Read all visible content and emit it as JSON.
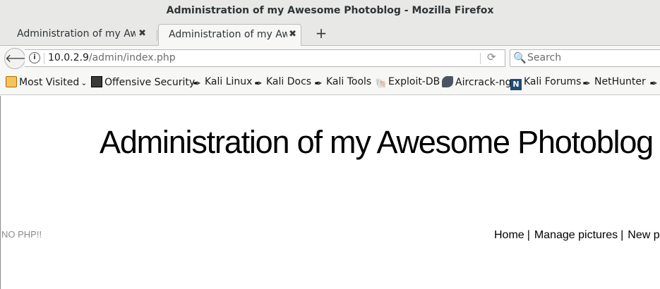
{
  "window": {
    "title": "Administration of my Awesome Photoblog - Mozilla Firefox"
  },
  "tabs": [
    {
      "label": "Administration of my Awesome Photoblog"
    },
    {
      "label": "Administration of my Awesome Photoblog"
    }
  ],
  "navbar": {
    "url_host": "10.0.2.9",
    "url_path": "/admin/index.php",
    "search_placeholder": "Search"
  },
  "bookmarks": [
    {
      "label": "Most Visited",
      "icon": "folder-icon"
    },
    {
      "label": "Offensive Security",
      "icon": "offsec-icon"
    },
    {
      "label": "Kali Linux",
      "icon": "kali-dragon-icon"
    },
    {
      "label": "Kali Docs",
      "icon": "kali-dragon-icon"
    },
    {
      "label": "Kali Tools",
      "icon": "kali-dragon-icon"
    },
    {
      "label": "Exploit-DB",
      "icon": "exploit-db-icon"
    },
    {
      "label": "Aircrack-ng",
      "icon": "aircrack-icon"
    },
    {
      "label": "Kali Forums",
      "icon": "kali-forums-icon"
    },
    {
      "label": "NetHunter",
      "icon": "kali-dragon-icon"
    }
  ],
  "page": {
    "heading": "Administration of my Awesome Photoblog",
    "note": "NO PHP!!",
    "menu": [
      {
        "label": "Home"
      },
      {
        "label": "Manage pictures"
      },
      {
        "label": "New picture"
      }
    ]
  }
}
